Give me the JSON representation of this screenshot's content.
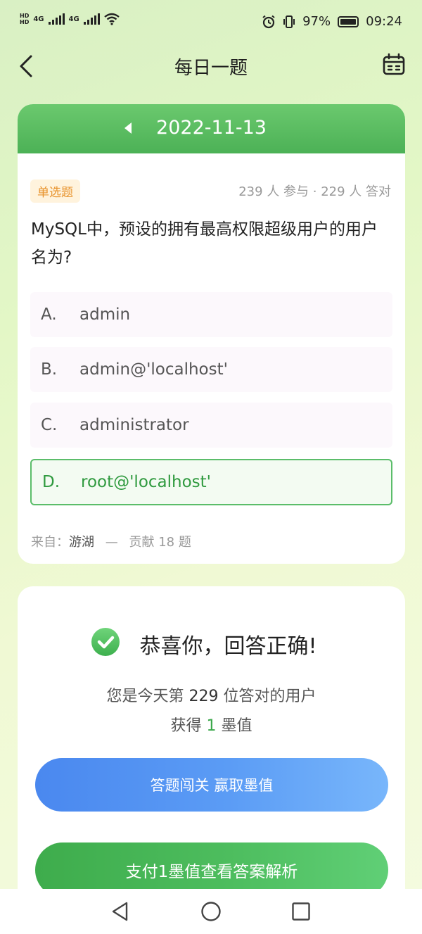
{
  "status_bar": {
    "network1": "4G",
    "network2": "4G",
    "hd1": "HD",
    "hd2": "HD",
    "battery": "97%",
    "time": "09:24"
  },
  "nav": {
    "title": "每日一题"
  },
  "question_card": {
    "date": "2022-11-13",
    "tag": "单选题",
    "stats": "239 人 参与 · 229 人 答对",
    "question": "MySQL中，预设的拥有最高权限超级用户的用户名为?",
    "options": [
      {
        "key": "A.",
        "text": "admin"
      },
      {
        "key": "B.",
        "text": "admin@'localhost'"
      },
      {
        "key": "C.",
        "text": "administrator"
      },
      {
        "key": "D.",
        "text": "root@'localhost'"
      }
    ],
    "selected_option": "D",
    "source_label": "来自：",
    "source_name": "游湖",
    "source_sep": "—",
    "source_contrib": "贡献 18 题"
  },
  "result_card": {
    "title": "恭喜你，回答正确!",
    "line1_prefix": "您是今天第 ",
    "line1_number": "229",
    "line1_suffix": " 位答对的用户",
    "line2_prefix": "获得 ",
    "line2_number": "1",
    "line2_suffix": " 墨值",
    "challenge_button": "答题闯关 赢取墨值",
    "answer_button": "支付1墨值查看答案解析"
  },
  "colors": {
    "accent_green": "#4cb156",
    "correct_border": "#5bbd6a",
    "tag_orange": "#e8932d",
    "button_blue": "#4a88ef"
  },
  "icons": {
    "back": "chevron-left-icon",
    "calendar": "calendar-icon",
    "check": "check-circle-icon"
  }
}
